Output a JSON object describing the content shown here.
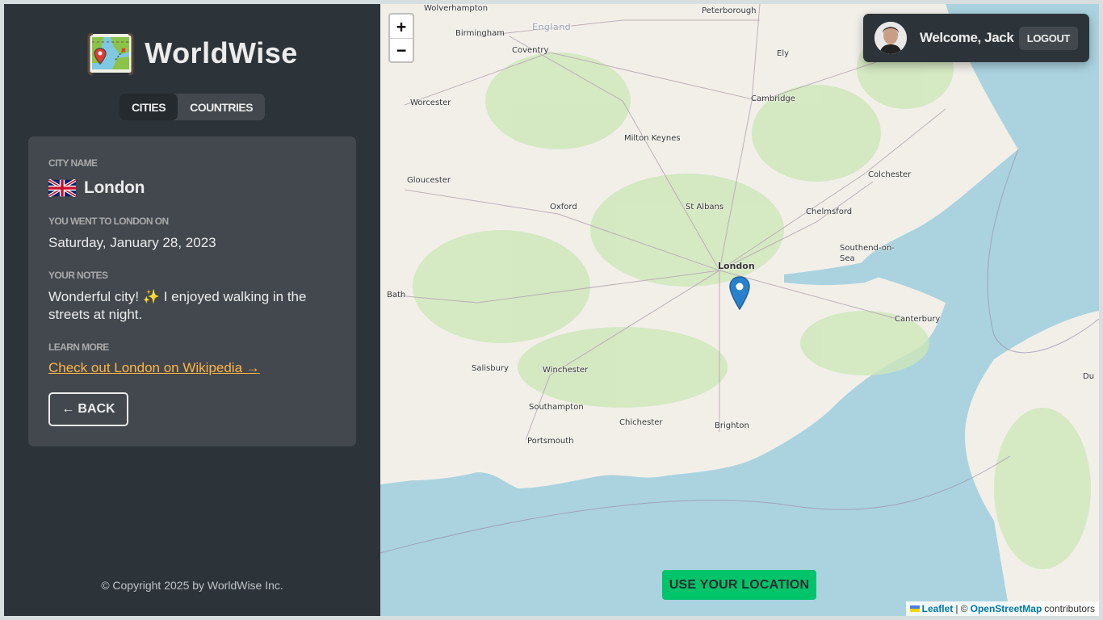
{
  "app": {
    "name": "WorldWise"
  },
  "tabs": [
    {
      "label": "Cities",
      "active": true
    },
    {
      "label": "Countries",
      "active": false
    }
  ],
  "city": {
    "name_label": "City name",
    "name": "London",
    "flag": "gb-flag-icon",
    "date_label": "You went to London on",
    "date": "Saturday, January 28, 2023",
    "notes_label": "Your notes",
    "notes": "Wonderful city! ✨ I enjoyed walking in the streets at night.",
    "learn_label": "Learn more",
    "wiki_link": "Check out London on Wikipedia →",
    "back_label": "BACK",
    "back_arrow": "←"
  },
  "footer": {
    "copyright": "© Copyright 2025 by WorldWise Inc."
  },
  "map": {
    "zoom_in": "+",
    "zoom_out": "−",
    "locate_label": "USE YOUR LOCATION",
    "attribution": {
      "leaflet": "Leaflet",
      "separator": "| ©",
      "osm": "OpenStreetMap",
      "suffix": "contributors"
    },
    "places": [
      "Wolverhampton",
      "Peterborough",
      "England",
      "Birmingham",
      "Coventry",
      "Ely",
      "Cambridge",
      "Worcester",
      "Milton Keynes",
      "Colchester",
      "Gloucester",
      "Oxford",
      "St Albans",
      "Chelmsford",
      "Southend-on-Sea",
      "London",
      "Bath",
      "Canterbury",
      "Salisbury",
      "Winchester",
      "Southampton",
      "Chichester",
      "Brighton",
      "Portsmouth",
      "Du"
    ]
  },
  "user": {
    "welcome": "Welcome, Jack",
    "logout": "LOGOUT"
  },
  "colors": {
    "sidebar_bg": "#2d3439",
    "card_bg": "#42484d",
    "brand_green": "#00c46a",
    "link_orange": "#ffb545",
    "sea": "#aad3df",
    "land": "#f2efe9",
    "marker_blue": "#2a81cb"
  }
}
